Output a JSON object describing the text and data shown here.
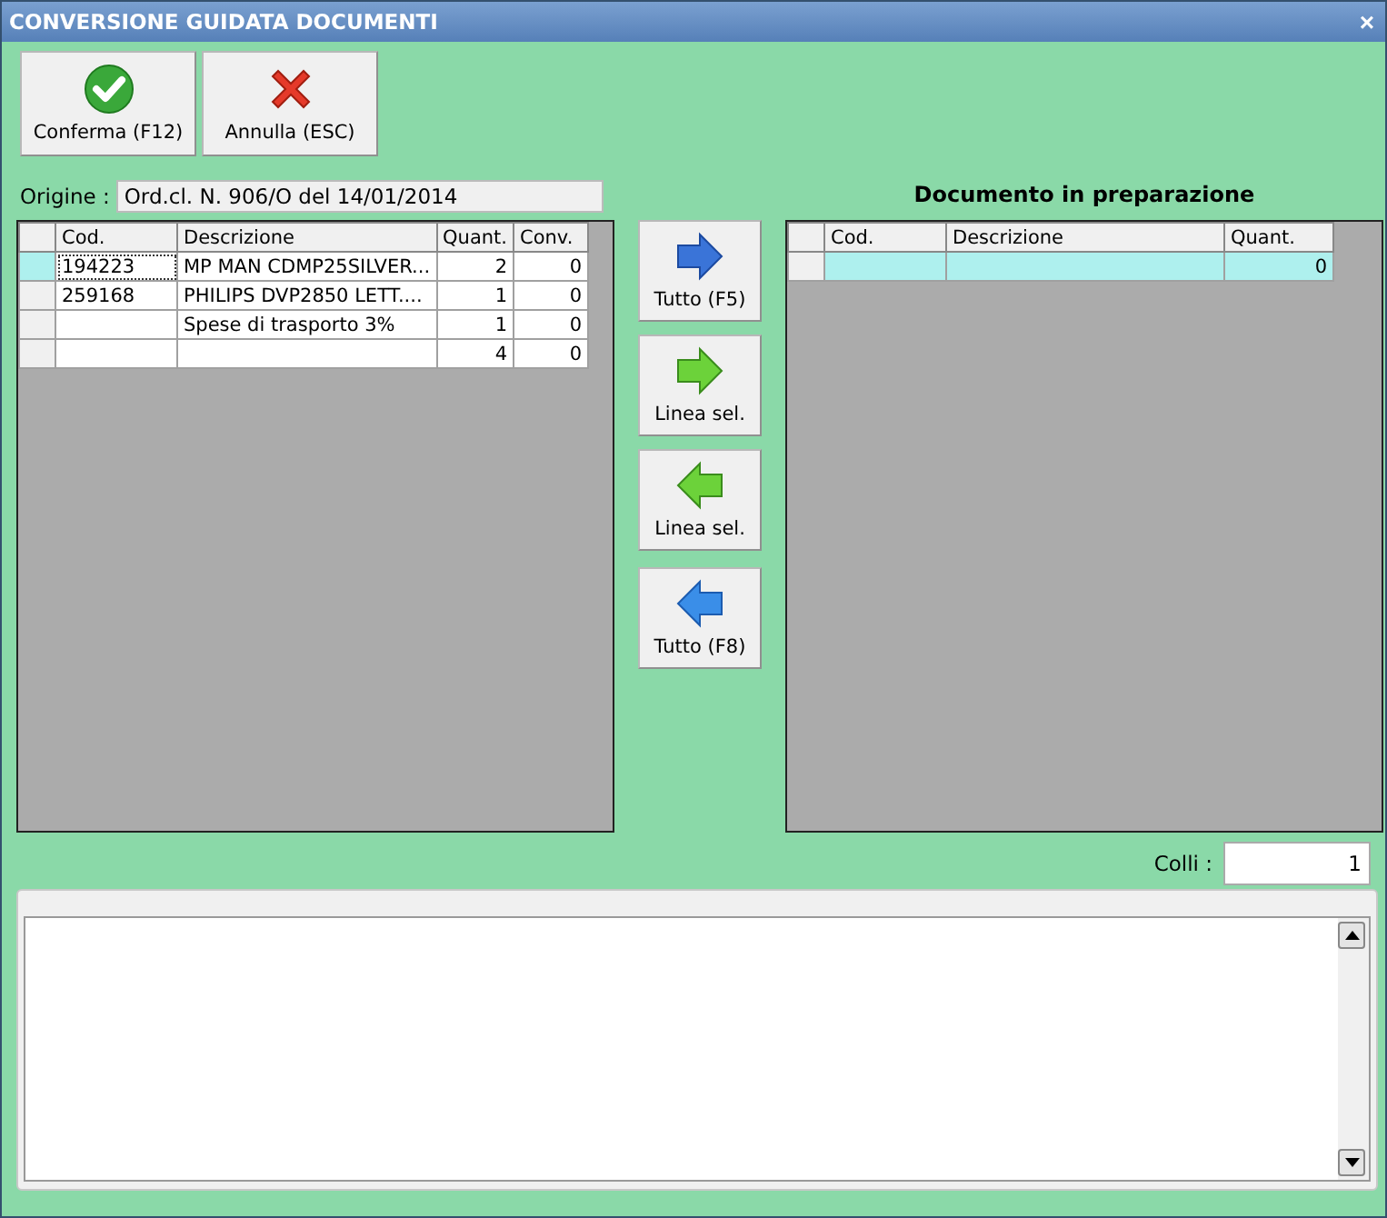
{
  "window": {
    "title": "CONVERSIONE GUIDATA DOCUMENTI",
    "close": "×"
  },
  "toolbar": [
    {
      "kind": "confirm",
      "label": "Conferma (F12)"
    },
    {
      "kind": "cancel",
      "label": "Annulla (ESC)"
    }
  ],
  "origin": {
    "label": "Origine :",
    "value": "Ord.cl. N. 906/O del 14/01/2014"
  },
  "source_grid": {
    "kind": "marker",
    "columns": [
      "Cod.",
      "Descrizione",
      "Quant.",
      "Conv."
    ],
    "rows": [
      {
        "cells": [
          "194223",
          "MP MAN CDMP25SILVER...",
          "2",
          "0"
        ],
        "selected": true
      },
      {
        "cells": [
          "259168",
          "PHILIPS DVP2850 LETT....",
          "1",
          "0"
        ],
        "selected": false
      },
      {
        "cells": [
          "",
          "Spese di trasporto 3%",
          "1",
          "0"
        ],
        "selected": false
      },
      {
        "cells": [
          "",
          "",
          "4",
          "0"
        ],
        "selected": false
      }
    ]
  },
  "transfer_buttons": [
    {
      "kind": "right-blue",
      "label": "Tutto (F5)"
    },
    {
      "kind": "right-green",
      "label": "Linea sel."
    },
    {
      "kind": "left-green",
      "label": "Linea sel."
    },
    {
      "kind": "left-blue",
      "label": "Tutto (F8)"
    }
  ],
  "target_grid": {
    "title": "Documento in preparazione",
    "kind": "fill",
    "columns": [
      "Cod.",
      "Descrizione",
      "Quant."
    ],
    "rows": [
      {
        "cells": [
          "",
          "",
          "0"
        ],
        "selected": true
      }
    ]
  },
  "colli": {
    "label": "Colli :",
    "value": "1"
  }
}
